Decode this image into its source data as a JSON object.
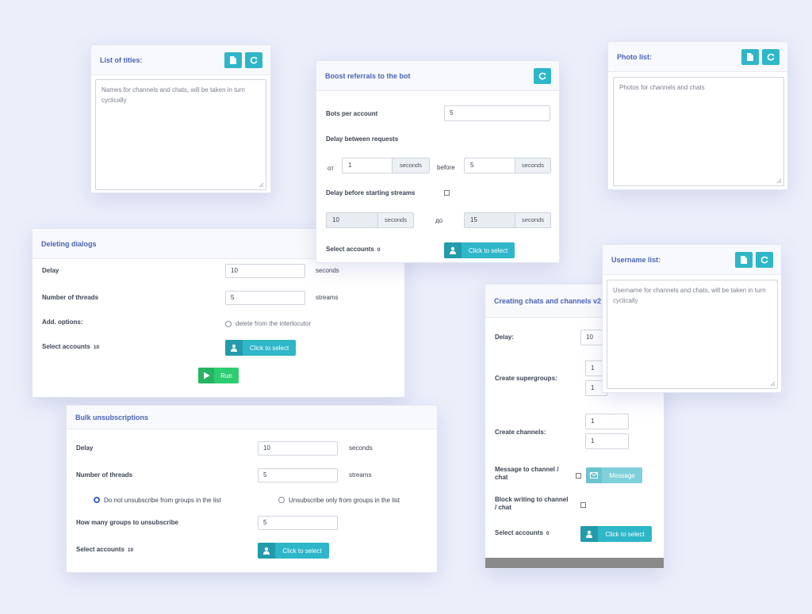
{
  "titles_card": {
    "title": "List of titles:",
    "textarea_placeholder": "Names for channels and chats, will be taken in turn cyclically",
    "file_icon": "file-icon",
    "refresh_icon": "refresh-icon"
  },
  "boost_card": {
    "title": "Boost referrals to the bot",
    "bots_per_account_label": "Bots per account",
    "bots_per_account_value": "5",
    "delay_requests_label": "Delay between requests",
    "from_label": "от",
    "delay_from_value": "1",
    "delay_from_unit": "seconds",
    "before_label": "before",
    "delay_to_value": "5",
    "delay_to_unit": "seconds",
    "delay_streams_label": "Delay before starting streams",
    "stream_from_value": "10",
    "stream_from_unit": "seconds",
    "to_label": "до",
    "stream_to_value": "15",
    "stream_to_unit": "seconds",
    "select_accounts_label": "Select accounts",
    "select_accounts_count": "0",
    "select_button": "Click to select"
  },
  "photo_card": {
    "title": "Photo list:",
    "textarea_placeholder": "Photos for channels and chats"
  },
  "deleting_card": {
    "title": "Deleting dialogs",
    "delay_label": "Delay",
    "delay_value": "10",
    "delay_unit": "seconds",
    "threads_label": "Number of threads",
    "threads_value": "5",
    "threads_unit": "streams",
    "options_label": "Add. options:",
    "option_delete_label": "delete from the interlocutor",
    "select_accounts_label": "Select accounts",
    "select_accounts_count": "10",
    "select_button": "Click to select",
    "run_button": "Run"
  },
  "creating_card": {
    "title": "Creating chats and channels v2",
    "delay_label": "Delay:",
    "delay_value": "10",
    "supergroups_label": "Create supergroups:",
    "supergroups_value_1": "1",
    "supergroups_value_2": "1",
    "channels_label": "Create channels:",
    "channels_value_1": "1",
    "channels_value_2": "1",
    "message_label": "Message to channel / chat",
    "message_button": "Message",
    "block_label": "Block writing to channel / chat",
    "select_accounts_label": "Select accounts",
    "select_accounts_count": "0",
    "select_button": "Click to select"
  },
  "username_card": {
    "title": "Username list:",
    "textarea_placeholder": "Username for channels and chats, will be taken in turn cyclically"
  },
  "bulk_card": {
    "title": "Bulk unsubscriptions",
    "delay_label": "Delay",
    "delay_value": "10",
    "delay_unit": "seconds",
    "threads_label": "Number of threads",
    "threads_value": "5",
    "threads_unit": "streams",
    "radio_1_label": "Do not unsubscribe from groups in the list",
    "radio_2_label": "Unsubscribe only from groups in the list",
    "groups_label": "How many groups to unsubscribe",
    "groups_value": "5",
    "select_accounts_label": "Select accounts",
    "select_accounts_count": "10",
    "select_button": "Click to select"
  },
  "colors": {
    "accent": "#2eb6c9",
    "title_blue": "#4a63b5",
    "run_green": "#2ecc71",
    "background": "#eceffa"
  }
}
